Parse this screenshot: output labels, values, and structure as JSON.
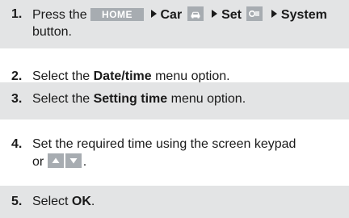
{
  "steps": [
    {
      "number": "1.",
      "prefix": "Press the",
      "home_button": "HOME",
      "car_label": "Car",
      "car_icon": "car-icon",
      "set_label": "Set",
      "set_icon": "settings-sliders-icon",
      "system_label": "System",
      "line2": "button."
    },
    {
      "number": "2.",
      "prefix": "Select the",
      "bold": "Date/time",
      "suffix": "menu option."
    },
    {
      "number": "3.",
      "prefix": "Select the",
      "bold": "Setting time",
      "suffix": "menu option."
    },
    {
      "number": "4.",
      "line1": "Set the required time using the screen keypad",
      "line2_prefix": "or",
      "key_icons": [
        "arrow-up-icon",
        "arrow-down-icon"
      ],
      "line2_suffix": "."
    },
    {
      "number": "5.",
      "prefix": "Select",
      "bold": "OK",
      "suffix": "."
    }
  ],
  "colors": {
    "shade": "#e3e4e5",
    "button_gray": "#a7acb1",
    "text": "#1a1a1a"
  }
}
